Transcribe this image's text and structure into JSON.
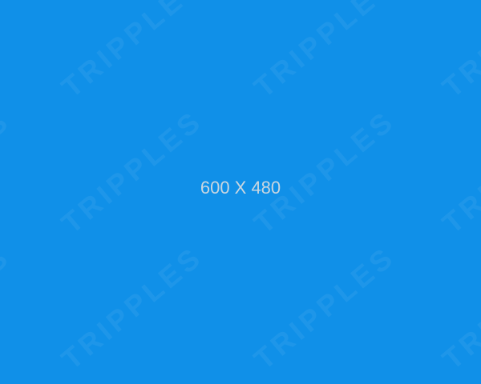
{
  "placeholder": {
    "label": "600 X 480",
    "watermark_text": "TRIPPLES",
    "background_color": "#1090E8",
    "label_color": "#C9D6E0",
    "watermark_color": "#FFFFFF"
  }
}
